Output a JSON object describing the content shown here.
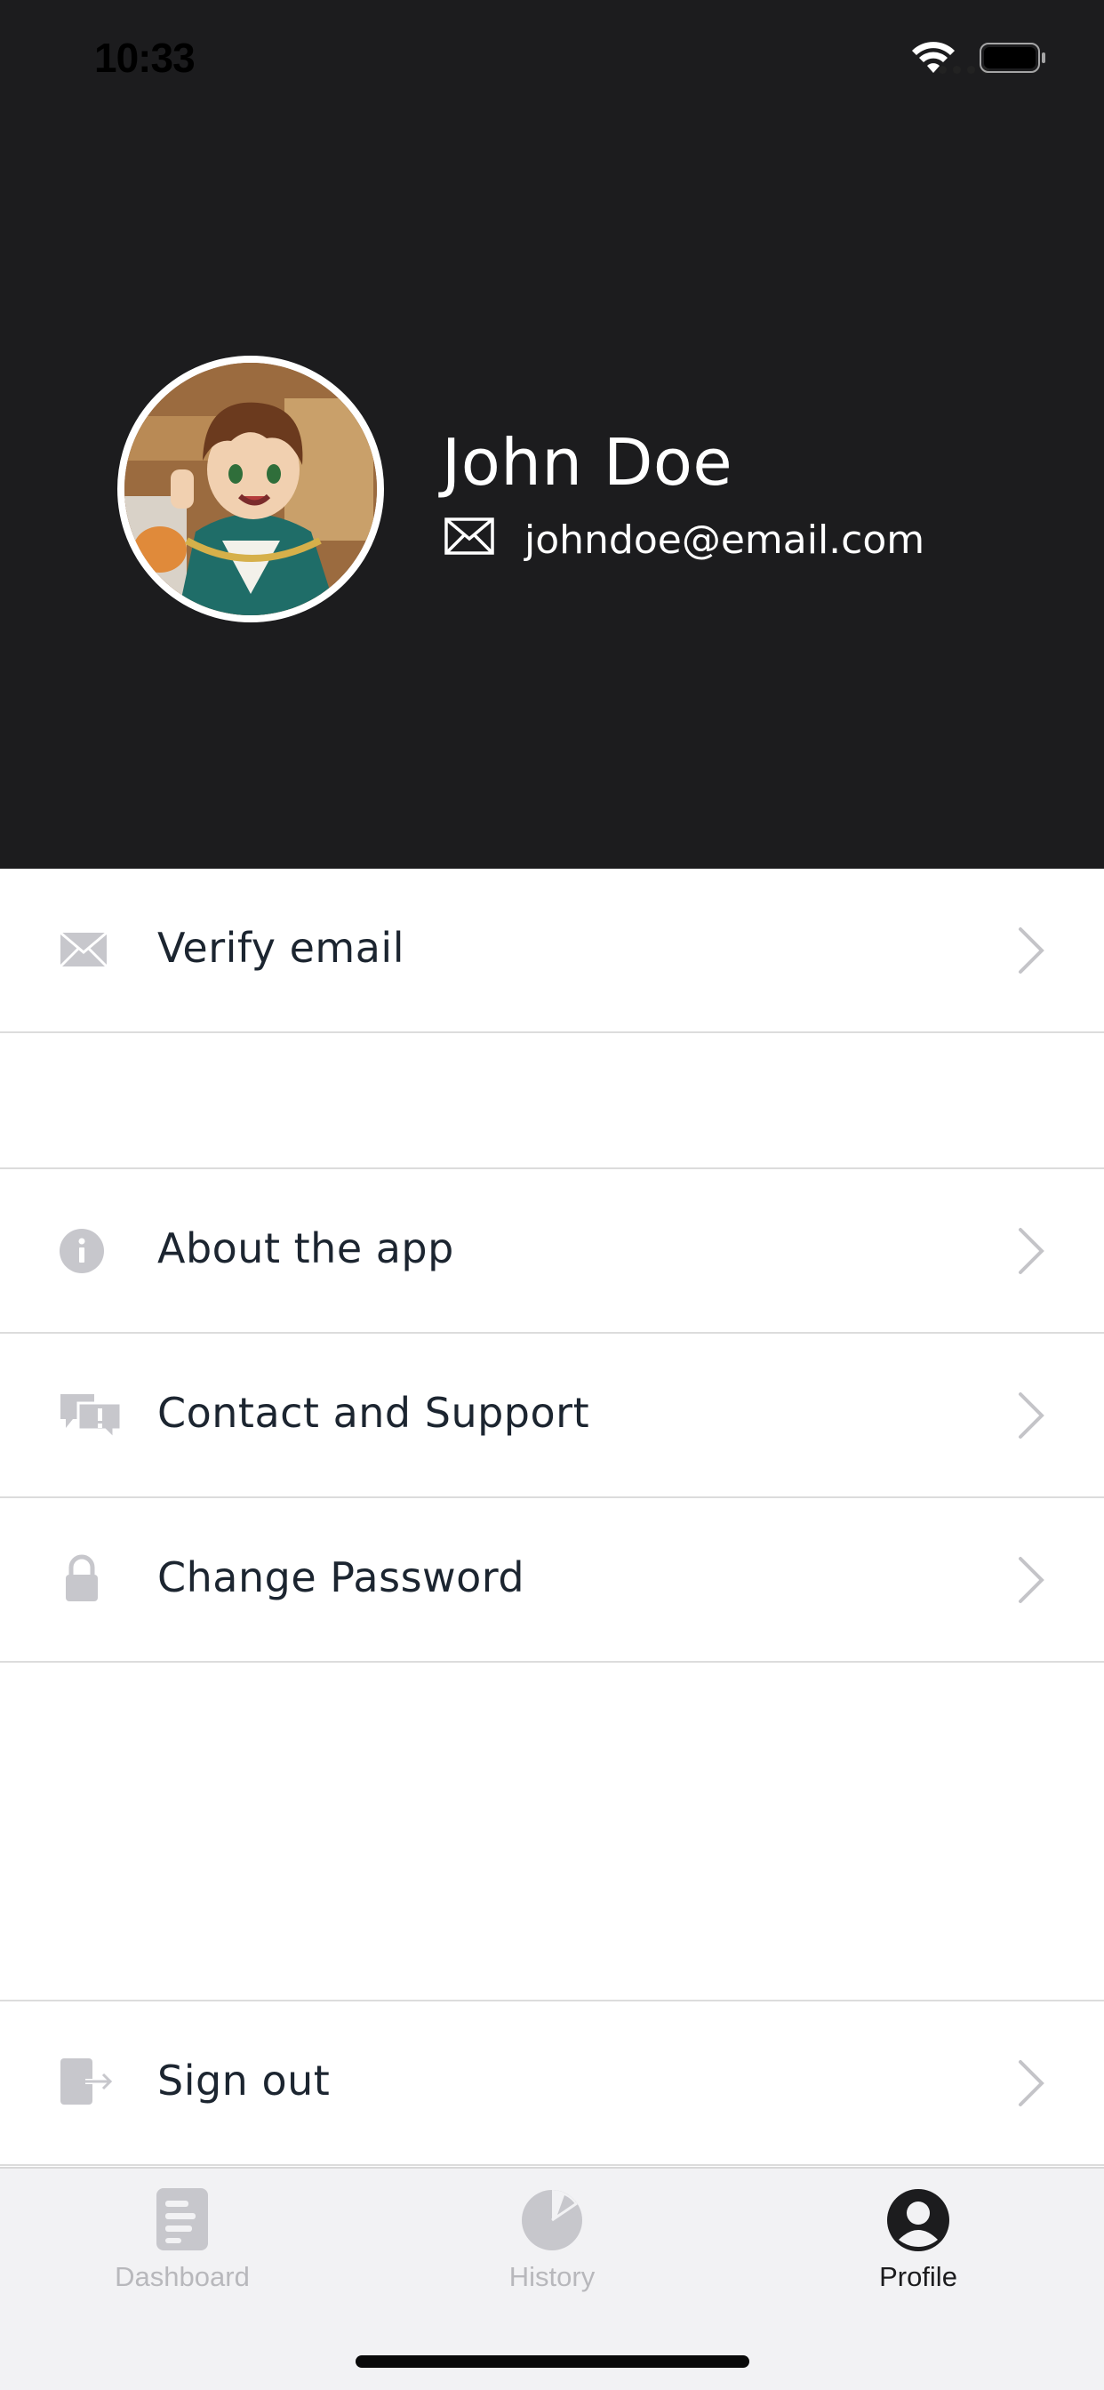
{
  "status_bar": {
    "time": "10:33"
  },
  "profile": {
    "name": "John Doe",
    "email": "johndoe@email.com"
  },
  "menu": {
    "verify_email": "Verify email",
    "about_app": "About the app",
    "contact_support": "Contact and Support",
    "change_password": "Change Password",
    "sign_out": "Sign out"
  },
  "tabs": [
    {
      "label": "Dashboard",
      "icon": "document-icon",
      "active": false
    },
    {
      "label": "History",
      "icon": "pie-chart-icon",
      "active": false
    },
    {
      "label": "Profile",
      "icon": "user-circle-icon",
      "active": true
    }
  ],
  "colors": {
    "header_bg": "#1c1c1e",
    "icon_gray": "#c7c7cc",
    "text_dark": "#1c2530",
    "tab_inactive": "#b8b8bc"
  }
}
